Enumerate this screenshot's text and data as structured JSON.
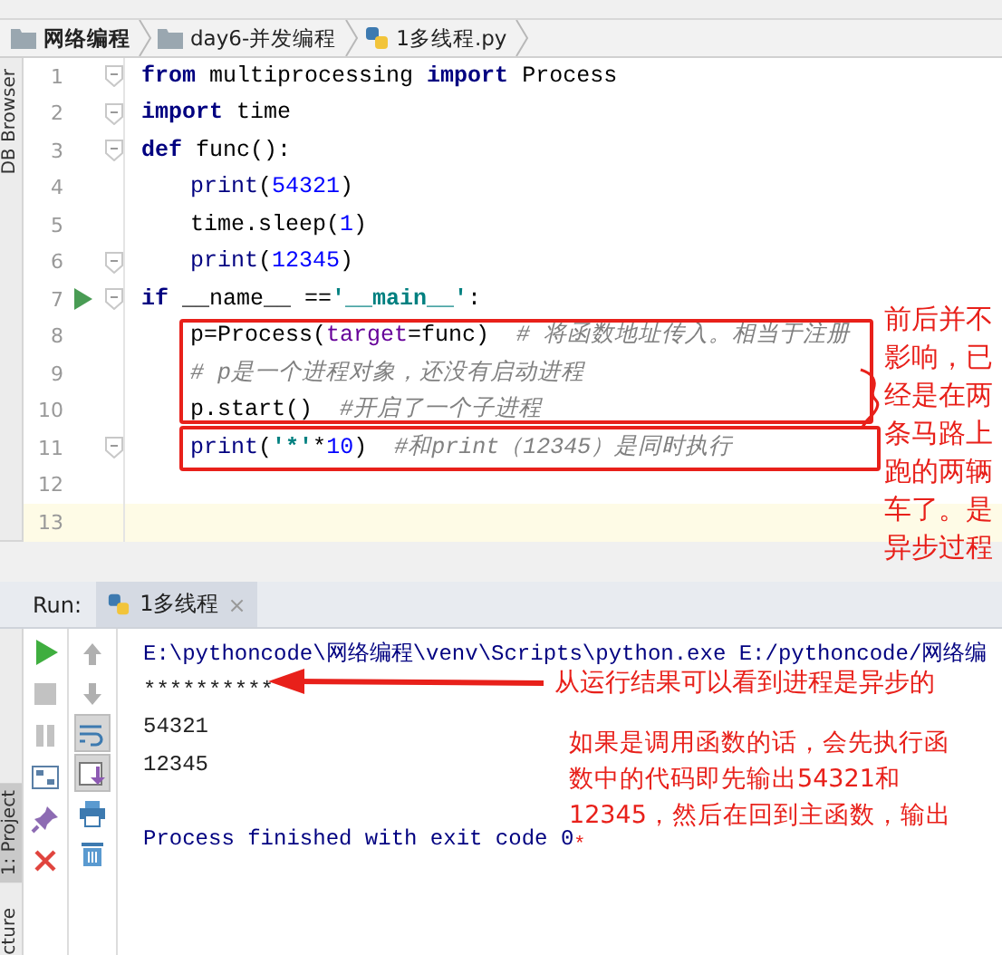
{
  "breadcrumb": [
    {
      "label": "网络编程",
      "kind": "folder",
      "bold": true
    },
    {
      "label": "day6-并发编程",
      "kind": "folder",
      "bold": false
    },
    {
      "label": "1多线程.py",
      "kind": "python",
      "bold": false
    }
  ],
  "side_tabs": {
    "top": "DB Browser",
    "project": "1: Project",
    "structure": "cture"
  },
  "code_lines": [
    {
      "no": "1",
      "run": false,
      "fold": true,
      "current": false,
      "tokens": [
        {
          "kind": "kw",
          "text": "from"
        },
        {
          "kind": "plain",
          "text": " multiprocessing "
        },
        {
          "kind": "kw",
          "text": "import"
        },
        {
          "kind": "plain",
          "text": " Process"
        }
      ]
    },
    {
      "no": "2",
      "run": false,
      "fold": true,
      "current": false,
      "tokens": [
        {
          "kind": "kw",
          "text": "import"
        },
        {
          "kind": "plain",
          "text": " time"
        }
      ]
    },
    {
      "no": "3",
      "run": false,
      "fold": true,
      "current": false,
      "tokens": [
        {
          "kind": "kw",
          "text": "def"
        },
        {
          "kind": "plain",
          "text": " func():"
        }
      ],
      "children": [
        {
          "no": "4",
          "run": false,
          "fold": false,
          "current": false,
          "tokens": [
            {
              "kind": "builtin",
              "text": "print"
            },
            {
              "kind": "plain",
              "text": "("
            },
            {
              "kind": "num",
              "text": "54321"
            },
            {
              "kind": "plain",
              "text": ")"
            }
          ]
        },
        {
          "no": "5",
          "run": false,
          "fold": false,
          "current": false,
          "tokens": [
            {
              "kind": "plain",
              "text": "time.sleep("
            },
            {
              "kind": "num",
              "text": "1"
            },
            {
              "kind": "plain",
              "text": ")"
            }
          ]
        },
        {
          "no": "6",
          "run": false,
          "fold": true,
          "current": false,
          "tokens": [
            {
              "kind": "builtin",
              "text": "print"
            },
            {
              "kind": "plain",
              "text": "("
            },
            {
              "kind": "num",
              "text": "12345"
            },
            {
              "kind": "plain",
              "text": ")"
            }
          ]
        }
      ]
    },
    {
      "no": "7",
      "run": true,
      "fold": true,
      "current": false,
      "tokens": [
        {
          "kind": "kw",
          "text": "if"
        },
        {
          "kind": "plain",
          "text": " __name__ =="
        },
        {
          "kind": "str",
          "text": "'__main__'"
        },
        {
          "kind": "plain",
          "text": ":"
        }
      ],
      "children": [
        {
          "no": "8",
          "run": false,
          "fold": false,
          "current": false,
          "tokens": [
            {
              "kind": "plain",
              "text": "p=Process("
            },
            {
              "kind": "param",
              "text": "target"
            },
            {
              "kind": "plain",
              "text": "=func)  "
            },
            {
              "kind": "comment",
              "text": "# 将函数地址传入。相当于注册"
            }
          ]
        },
        {
          "no": "9",
          "run": false,
          "fold": false,
          "current": false,
          "tokens": [
            {
              "kind": "comment",
              "text": "# p是一个进程对象，还没有启动进程"
            }
          ]
        },
        {
          "no": "10",
          "run": false,
          "fold": false,
          "current": false,
          "tokens": [
            {
              "kind": "plain",
              "text": "p.start()  "
            },
            {
              "kind": "comment",
              "text": "#开启了一个子进程"
            }
          ]
        },
        {
          "no": "11",
          "run": false,
          "fold": true,
          "current": false,
          "tokens": [
            {
              "kind": "builtin",
              "text": "print"
            },
            {
              "kind": "plain",
              "text": "("
            },
            {
              "kind": "str",
              "text": "'*'"
            },
            {
              "kind": "plain",
              "text": "*"
            },
            {
              "kind": "num",
              "text": "10"
            },
            {
              "kind": "plain",
              "text": ")  "
            },
            {
              "kind": "comment",
              "text": "#和print（12345）是同时执行"
            }
          ]
        }
      ]
    },
    {
      "no": "12",
      "run": false,
      "fold": false,
      "current": false
    },
    {
      "no": "13",
      "run": false,
      "fold": false,
      "current": true
    }
  ],
  "run_panel": {
    "label": "Run:",
    "tab": "1多线程",
    "close": "×",
    "left_toolbar": [
      {
        "kind": "run"
      },
      {
        "kind": "stop"
      },
      {
        "kind": "pause"
      },
      {
        "kind": "layout"
      },
      {
        "kind": "pin"
      },
      {
        "kind": "close"
      }
    ],
    "right_toolbar": [
      {
        "kind": "up",
        "on": false
      },
      {
        "kind": "down",
        "on": false
      },
      {
        "kind": "wrap",
        "on": true
      },
      {
        "kind": "scroll-end",
        "on": true
      },
      {
        "kind": "print",
        "on": false
      },
      {
        "kind": "trash",
        "on": false
      }
    ],
    "output": [
      "E:\\pythoncode\\网络编程\\venv\\Scripts\\python.exe E:/pythoncode/网络编",
      "**********",
      "54321",
      "12345",
      "Process finished with exit code 0"
    ],
    "end_mark": "*"
  },
  "annotations": {
    "side_note": "前后并不影响，已经是在两条马路上跑的两辆车了。是异步过程",
    "arrow_note": "从运行结果可以看到进程是异步的",
    "paragraph": "如果是调用函数的话，会先执行函数中的代码即先输出54321和12345，然后在回到主函数，输出"
  }
}
